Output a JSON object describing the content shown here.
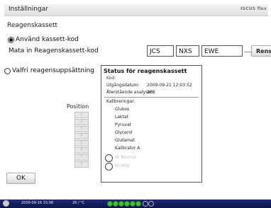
{
  "window": {
    "title": "Inställningar",
    "brand": "ISCUS flex"
  },
  "reagent": {
    "section_title": "Reagenskassett",
    "option_use_code": "Använd kassett-kod",
    "enter_code_label": "Mata in Reagenskassett-kod",
    "codes": [
      "JCS",
      "NXS",
      "EWE"
    ],
    "clear_label": "Rensa",
    "option_custom": "Valfri reagensuppsättning"
  },
  "status": {
    "header": "Status för reagenskassett",
    "kod_label": "Kod:",
    "expiry_label": "Utgångsdatum:",
    "expiry_value": "2009-09-21 12:03:52",
    "remaining_label": "Återstående analyser:",
    "remaining_value": "308",
    "calibrations_label": "Kalibreringar:",
    "calibrations": [
      "Glukos",
      "Laktat",
      "Pyruvat",
      "Glycerol",
      "Glutamat",
      "Kalibrator A"
    ],
    "controls": [
      "Kt Normal",
      "Kt Hög"
    ]
  },
  "position": {
    "label": "Position",
    "buttons": [
      "1",
      "2",
      "3",
      "4",
      "5",
      "6",
      "7",
      "8"
    ]
  },
  "ok_label": "OK",
  "taskbar": {
    "datetime": "2009-09-16 15:08",
    "temperature": "26 / °C",
    "indicators": [
      {
        "state": "on",
        "color": "#44c23a"
      },
      {
        "state": "on",
        "color": "#44c23a"
      },
      {
        "state": "on",
        "color": "#44c23a"
      },
      {
        "state": "on",
        "color": "#44c23a"
      },
      {
        "state": "on",
        "color": "#44c23a"
      },
      {
        "state": "on",
        "color": "#44c23a"
      },
      {
        "state": "off",
        "color": "#b0b0b0"
      },
      {
        "state": "off",
        "color": "#b0b0b0"
      }
    ]
  }
}
